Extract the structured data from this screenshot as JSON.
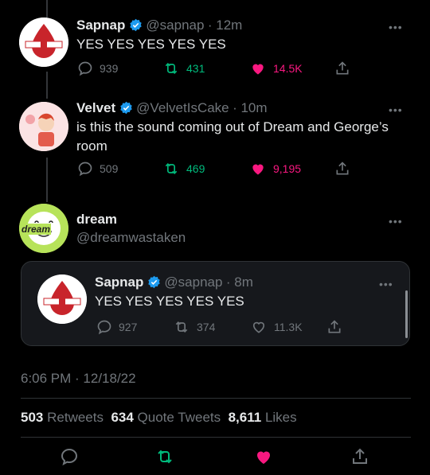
{
  "tweets": [
    {
      "name": "Sapnap",
      "handle": "@sapnap",
      "time": "· 12m",
      "text": "YES YES YES YES YES",
      "avatar_text": "SAPNAP",
      "replies": "939",
      "retweets": "431",
      "likes": "14.5K"
    },
    {
      "name": "Velvet",
      "handle": "@VelvetIsCake",
      "time": "· 10m",
      "text_line1": "is this the sound coming out of Dream and George’s",
      "text_line2": "room",
      "replies": "509",
      "retweets": "469",
      "likes": "9,195"
    }
  ],
  "main": {
    "name": "dream",
    "handle": "@dreamwastaken",
    "avatar_text": "dream"
  },
  "quoted": {
    "name": "Sapnap",
    "handle": "@sapnap",
    "time": "· 8m",
    "text": "YES YES YES YES YES",
    "avatar_text": "SAPNAP",
    "replies": "927",
    "retweets": "374",
    "likes": "11.3K"
  },
  "timestamp": "6:06 PM · 12/18/22",
  "stats": {
    "retweets_count": "503",
    "retweets_label": "Retweets",
    "quotes_count": "634",
    "quotes_label": "Quote Tweets",
    "likes_count": "8,611",
    "likes_label": "Likes"
  },
  "more_glyph": "•••",
  "colors": {
    "verified": "#1d9bf0",
    "retweet": "#00ba7c",
    "like": "#f91880",
    "muted": "#71767b"
  }
}
